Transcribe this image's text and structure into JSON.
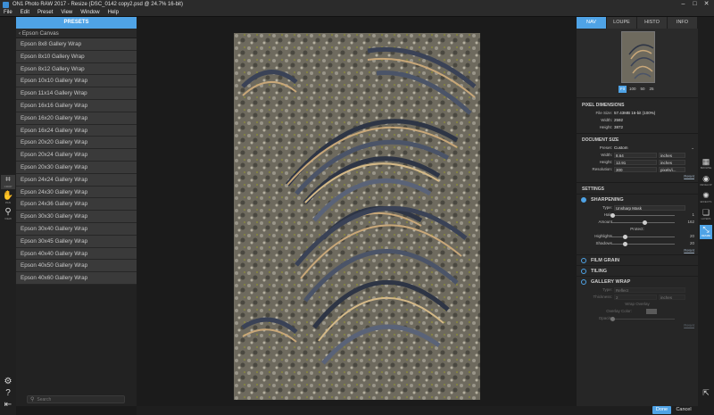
{
  "window": {
    "title": "ON1 Photo RAW 2017 - Resize (DSC_0142 copy2.psd @ 24.7% 16-bit)"
  },
  "menu": [
    "File",
    "Edit",
    "Preset",
    "View",
    "Window",
    "Help"
  ],
  "left_tools": [
    {
      "icon": "crop-icon",
      "label": "CROP"
    },
    {
      "icon": "hand-icon",
      "label": "PAN"
    },
    {
      "icon": "zoom-icon",
      "label": "VIEW"
    }
  ],
  "presets": {
    "header": "PRESETS",
    "back_label": "Epson Canvas",
    "items": [
      "Epson 8x8 Gallery Wrap",
      "Epson 8x10 Gallery Wrap",
      "Epson 8x12 Gallery Wrap",
      "Epson 10x10 Gallery Wrap",
      "Epson 11x14 Gallery Wrap",
      "Epson 16x16 Gallery Wrap",
      "Epson 16x20 Gallery Wrap",
      "Epson 16x24 Gallery Wrap",
      "Epson 20x20 Gallery Wrap",
      "Epson 20x24 Gallery Wrap",
      "Epson 20x30 Gallery Wrap",
      "Epson 24x24 Gallery Wrap",
      "Epson 24x30 Gallery Wrap",
      "Epson 24x36 Gallery Wrap",
      "Epson 30x30 Gallery Wrap",
      "Epson 30x40 Gallery Wrap",
      "Epson 30x45 Gallery Wrap",
      "Epson 40x40 Gallery Wrap",
      "Epson 40x50 Gallery Wrap",
      "Epson 40x60 Gallery Wrap"
    ],
    "search_placeholder": "Search"
  },
  "tabs": [
    "NAV",
    "LOUPE",
    "HISTO",
    "INFO"
  ],
  "zoom_levels": [
    "Fit",
    "100",
    "50",
    "25"
  ],
  "pixel_dimensions": {
    "title": "PIXEL DIMENSIONS",
    "file_size_label": "File Size:",
    "file_size": "57.43MB 16-bit (100%)",
    "width_label": "Width:",
    "width": "2592",
    "height_label": "Height:",
    "height": "3872"
  },
  "document_size": {
    "title": "DOCUMENT SIZE",
    "preset_label": "Preset:",
    "preset": "Custom",
    "width_label": "Width:",
    "width": "8.64",
    "height_label": "Height:",
    "height": "12.91",
    "unit": "inches",
    "resolution_label": "Resolution:",
    "resolution": "300",
    "resolution_unit": "pixels/i...",
    "reset": "Reset"
  },
  "settings": {
    "title": "SETTINGS",
    "sharpening": {
      "title": "SHARPENING",
      "type_label": "Type:",
      "type": "Unsharp Mask",
      "halo_label": "Halo",
      "halo": "1",
      "amount_label": "Amount",
      "amount": "162",
      "protect_label": "Protect:",
      "highlights_label": "Highlights",
      "highlights": "20",
      "shadows_label": "Shadows",
      "shadows": "20",
      "reset": "Reset"
    },
    "film_grain": "FILM GRAIN",
    "tiling": "TILING",
    "gallery_wrap": {
      "title": "GALLERY WRAP",
      "type_label": "Type:",
      "type": "Reflect",
      "thickness_label": "Thickness:",
      "thickness": "2",
      "thickness_unit": "inches",
      "overlay_title": "Wrap Overlay",
      "overlay_color_label": "Overlay Color:",
      "opacity_label": "Opacity",
      "reset": "Reset"
    }
  },
  "right_tools": [
    {
      "icon": "browse-icon",
      "label": "BROWSE"
    },
    {
      "icon": "develop-icon",
      "label": "DEVELOP"
    },
    {
      "icon": "effects-icon",
      "label": "EFFECTS"
    },
    {
      "icon": "layers-icon",
      "label": "LAYERS"
    },
    {
      "icon": "resize-icon",
      "label": "RESIZE"
    }
  ],
  "buttons": {
    "done": "Done",
    "cancel": "Cancel"
  },
  "colors": {
    "accent": "#4fa3e6"
  }
}
